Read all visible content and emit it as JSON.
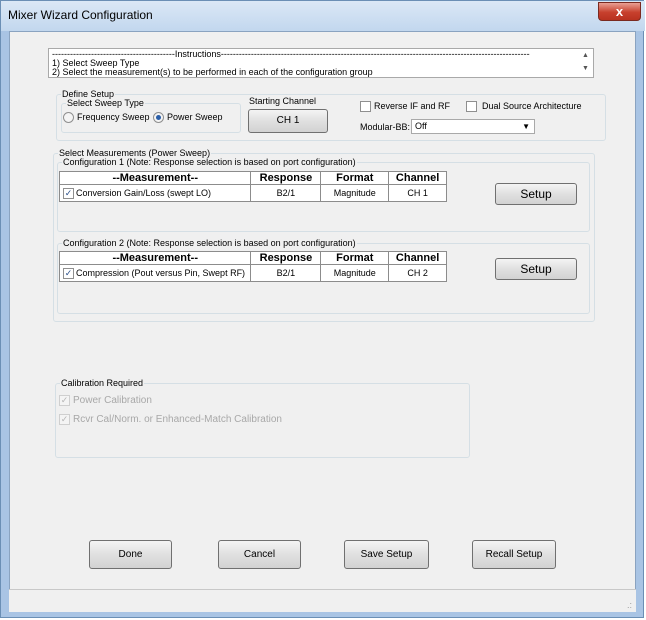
{
  "window": {
    "title": "Mixer Wizard Configuration",
    "close_glyph": "x"
  },
  "instructions": {
    "header": "-----------------------------------------Instructions-------------------------------------------------------------------------------------------------------",
    "lines": [
      "1) Select Sweep Type",
      "2) Select the measurement(s) to be performed in each of the configuration group"
    ]
  },
  "define_setup": {
    "legend": "Define Setup",
    "sweep_type": {
      "legend": "Select Sweep Type",
      "options": [
        "Frequency Sweep",
        "Power Sweep"
      ],
      "selected": "Power Sweep"
    },
    "starting_channel": {
      "label": "Starting Channel",
      "value": "CH 1"
    },
    "reverse_if_rf": {
      "label": "Reverse IF and RF",
      "checked": false
    },
    "dual_source": {
      "label": "Dual Source Architecture",
      "checked": false
    },
    "modular_bb": {
      "label": "Modular-BB:",
      "value": "Off"
    }
  },
  "select_measurements": {
    "legend": "Select Measurements (Power Sweep)",
    "columns": [
      "--Measurement--",
      "Response",
      "Format",
      "Channel"
    ],
    "config1": {
      "legend": "Configuration 1 (Note: Response selection is based on port configuration)",
      "row": {
        "measurement": "Conversion Gain/Loss (swept LO)",
        "response": "B2/1",
        "format": "Magnitude",
        "channel": "CH 1",
        "checked": true
      },
      "setup_label": "Setup"
    },
    "config2": {
      "legend": "Configuration 2 (Note: Response selection is based on port configuration)",
      "row": {
        "measurement": "Compression (Pout versus Pin, Swept RF)",
        "response": "B2/1",
        "format": "Magnitude",
        "channel": "CH 2",
        "checked": true
      },
      "setup_label": "Setup"
    }
  },
  "calibration": {
    "legend": "Calibration Required",
    "items": [
      "Power Calibration",
      "Rcvr Cal/Norm. or Enhanced-Match Calibration"
    ]
  },
  "buttons": {
    "done": "Done",
    "cancel": "Cancel",
    "save": "Save Setup",
    "recall": "Recall Setup"
  },
  "colors": {
    "accent": "#2a5ea8",
    "close": "#c7402d",
    "frame": "#a9c4e4"
  },
  "icons": {
    "close": "close-icon",
    "grip": "resize-grip-icon",
    "dropdown": "chevron-down-icon"
  }
}
